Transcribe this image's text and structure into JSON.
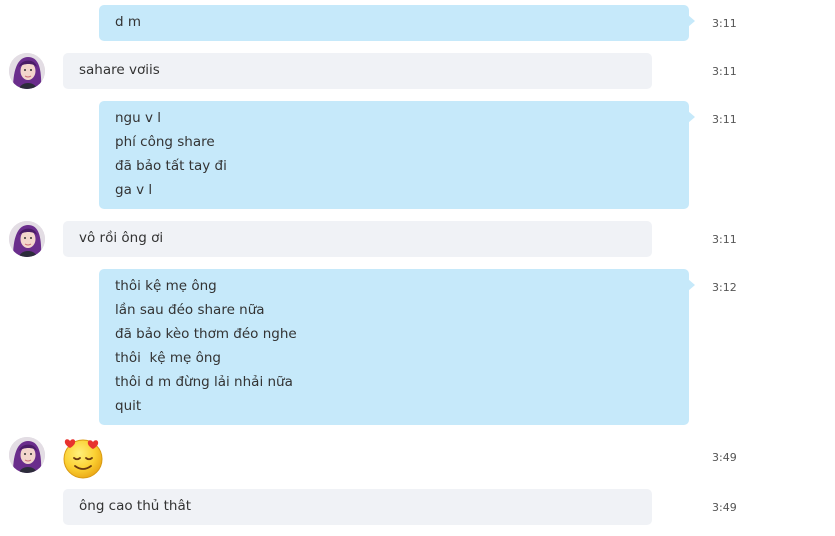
{
  "messages": [
    {
      "direction": "out",
      "lines": [
        "d m"
      ],
      "time": "3:11"
    },
    {
      "direction": "in",
      "lines": [
        "sahare vơiis"
      ],
      "time": "3:11"
    },
    {
      "direction": "out",
      "lines": [
        "ngu v l",
        "phí công share",
        "đã bảo tất tay đi",
        "ga v l"
      ],
      "time": "3:11"
    },
    {
      "direction": "in",
      "lines": [
        "vô rồi ông ơi"
      ],
      "time": "3:11"
    },
    {
      "direction": "out",
      "lines": [
        "thôi kệ mẹ ông",
        "lần sau đéo share nữa",
        "đã bảo kèo thơm đéo nghe",
        "thôi  kệ mẹ ông",
        "thôi d m đừng lải nhải nữa",
        "quit"
      ],
      "time": "3:12"
    },
    {
      "direction": "in",
      "emoji": "smiling-face-with-heart-eyes-icon",
      "time": "3:49"
    },
    {
      "direction": "in",
      "lines": [
        "ông cao thủ thât"
      ],
      "time": "3:49"
    }
  ],
  "colors": {
    "outgoing_bubble": "#c6e9fa",
    "incoming_bubble": "#f0f2f6",
    "timestamp": "#555555"
  }
}
